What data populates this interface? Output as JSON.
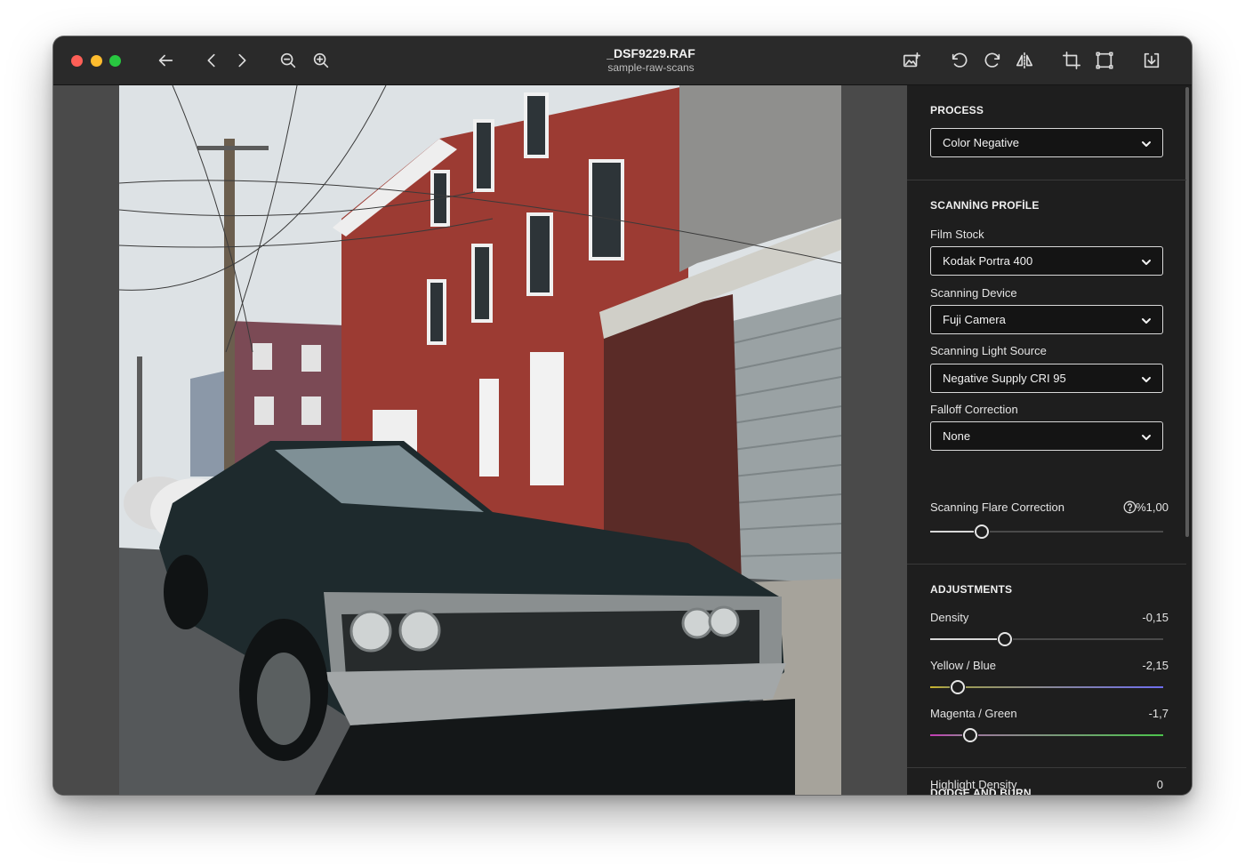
{
  "file": {
    "name": "_DSF9229.RAF",
    "folder": "sample-raw-scans"
  },
  "colors": {
    "accent_close": "#fe5f57",
    "accent_min": "#febc2e",
    "accent_max": "#28c840",
    "panel_bg": "#1e1e1e",
    "canvas_bg": "#4a4a4a"
  },
  "toolbar": {
    "left_icons": [
      "back-arrow-icon",
      "chevron-left-icon",
      "chevron-right-icon",
      "zoom-out-icon",
      "zoom-in-icon"
    ],
    "right_icons": [
      "image-settings-icon",
      "rotate-left-icon",
      "rotate-right-icon",
      "flip-horizontal-icon",
      "crop-icon",
      "frame-icon",
      "export-icon"
    ]
  },
  "process": {
    "heading": "PROCESS",
    "selected": "Color Negative"
  },
  "scanning_profile": {
    "heading": "SCANNİNG PROFİLE",
    "film_stock": {
      "label": "Film Stock",
      "value": "Kodak Portra 400"
    },
    "scanning_device": {
      "label": "Scanning Device",
      "value": "Fuji Camera"
    },
    "light_source": {
      "label": "Scanning Light Source",
      "value": "Negative Supply CRI 95"
    },
    "falloff": {
      "label": "Falloff Correction",
      "value": "None"
    },
    "flare": {
      "label": "Scanning Flare Correction",
      "value": "%1,00",
      "level": 0.22
    }
  },
  "adjustments": {
    "heading": "ADJUSTMENTS",
    "density": {
      "label": "Density",
      "value": "-0,15",
      "level": 0.32
    },
    "yellow_blue": {
      "label": "Yellow / Blue",
      "value": "-2,15",
      "level": 0.12
    },
    "magenta_green": {
      "label": "Magenta / Green",
      "value": "-1,7",
      "level": 0.17
    }
  },
  "dodge_burn": {
    "heading": "DODGE AND BURN",
    "highlight_density": {
      "label": "Highlight Density",
      "value": "0"
    }
  }
}
